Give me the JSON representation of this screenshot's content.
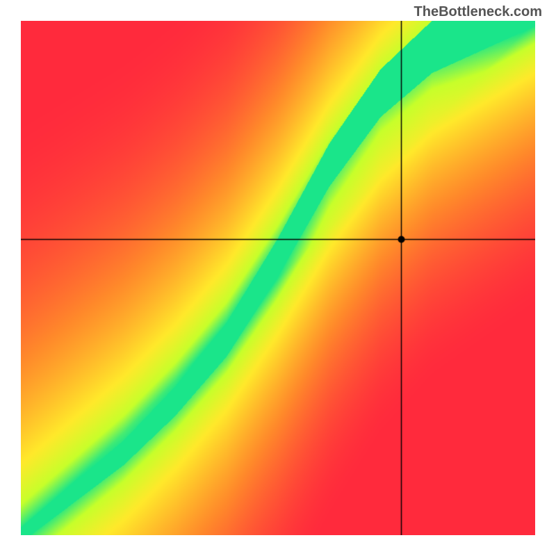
{
  "watermark": "TheBottleneck.com",
  "chart_data": {
    "type": "heatmap",
    "title": "",
    "xlabel": "",
    "ylabel": "",
    "xlim": [
      0,
      1
    ],
    "ylim": [
      0,
      1
    ],
    "crosshair": {
      "x": 0.74,
      "y": 0.575
    },
    "marker": {
      "x": 0.74,
      "y": 0.575
    },
    "optimal_curve": [
      {
        "x": 0.0,
        "y": 0.0
      },
      {
        "x": 0.1,
        "y": 0.08
      },
      {
        "x": 0.2,
        "y": 0.16
      },
      {
        "x": 0.3,
        "y": 0.26
      },
      {
        "x": 0.4,
        "y": 0.38
      },
      {
        "x": 0.5,
        "y": 0.54
      },
      {
        "x": 0.6,
        "y": 0.72
      },
      {
        "x": 0.7,
        "y": 0.86
      },
      {
        "x": 0.8,
        "y": 0.95
      },
      {
        "x": 0.9,
        "y": 1.0
      }
    ],
    "color_scale": [
      {
        "stop": 0.0,
        "color": "#ff2a3c"
      },
      {
        "stop": 0.35,
        "color": "#ff8a2a"
      },
      {
        "stop": 0.7,
        "color": "#ffe92a"
      },
      {
        "stop": 0.88,
        "color": "#c7ff2a"
      },
      {
        "stop": 1.0,
        "color": "#1ae58a"
      }
    ],
    "description": "Green band marks the balanced CPU/GPU region; red corners indicate severe bottleneck; crosshair shows the selected configuration just to the right of the balanced band (slight CPU-side bottleneck)."
  }
}
